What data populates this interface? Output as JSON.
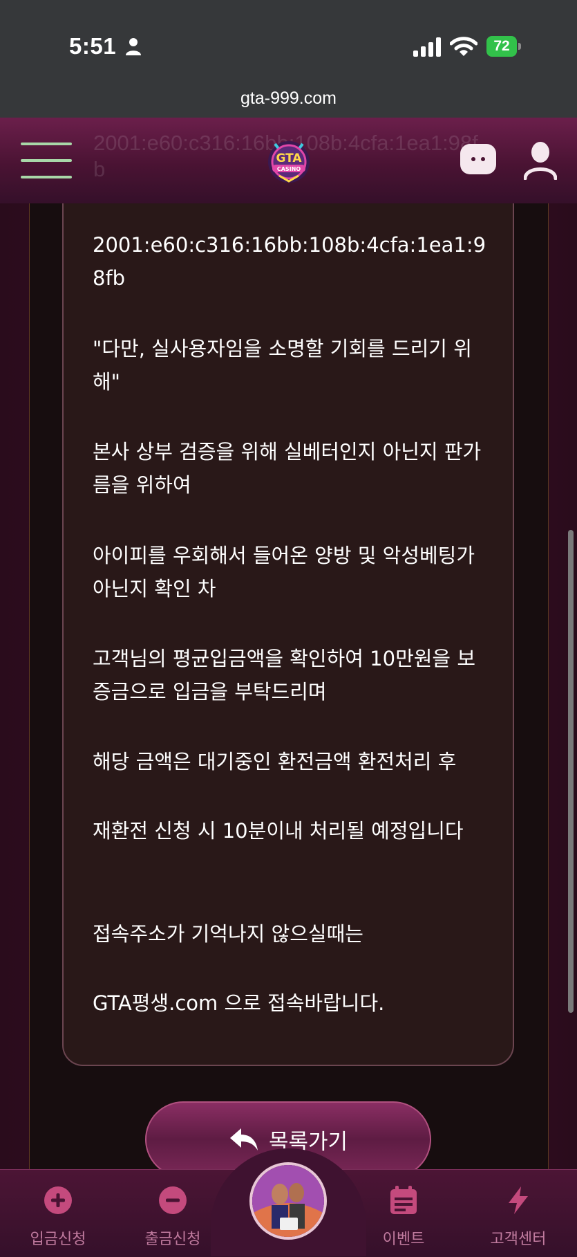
{
  "status_bar": {
    "time": "5:51",
    "battery": "72"
  },
  "browser": {
    "url": "gta-999.com"
  },
  "header": {
    "ghost_text": "2001:e60:c316:16bb:108b:4cfa:1ea1:98fb",
    "logo_text": "GTA",
    "logo_subtext": "CASINO"
  },
  "content": {
    "paragraphs": [
      "2001:e60:c316:16bb:108b:4cfa:1ea1:98fb",
      "\"다만, 실사용자임을 소명할 기회를 드리기 위해\"",
      "본사 상부 검증을 위해 실베터인지 아닌지 판가름을 위하여",
      "아이피를 우회해서 들어온 양방 및 악성베팅가 아닌지 확인 차",
      "고객님의 평균입금액을 확인하여 10만원을 보증금으로 입금을 부탁드리며",
      "해당 금액은 대기중인 환전금액 환전처리 후",
      "재환전 신청 시 10분이내 처리될 예정입니다",
      "접속주소가 기억나지 않으실때는",
      "GTA평생.com 으로 접속바랍니다."
    ],
    "back_button_label": "목록가기"
  },
  "bottom_nav": {
    "items": [
      {
        "label": "입금신청",
        "icon": "plus-circle-icon"
      },
      {
        "label": "출금신청",
        "icon": "minus-circle-icon"
      },
      {
        "label": "",
        "icon": "game-avatar"
      },
      {
        "label": "이벤트",
        "icon": "calendar-icon"
      },
      {
        "label": "고객센터",
        "icon": "lightning-icon"
      }
    ]
  },
  "colors": {
    "header_bg": "#4a1333",
    "card_bg": "#291818",
    "nav_label": "#c07a9e",
    "menu_lines": "#a8d7a8"
  }
}
